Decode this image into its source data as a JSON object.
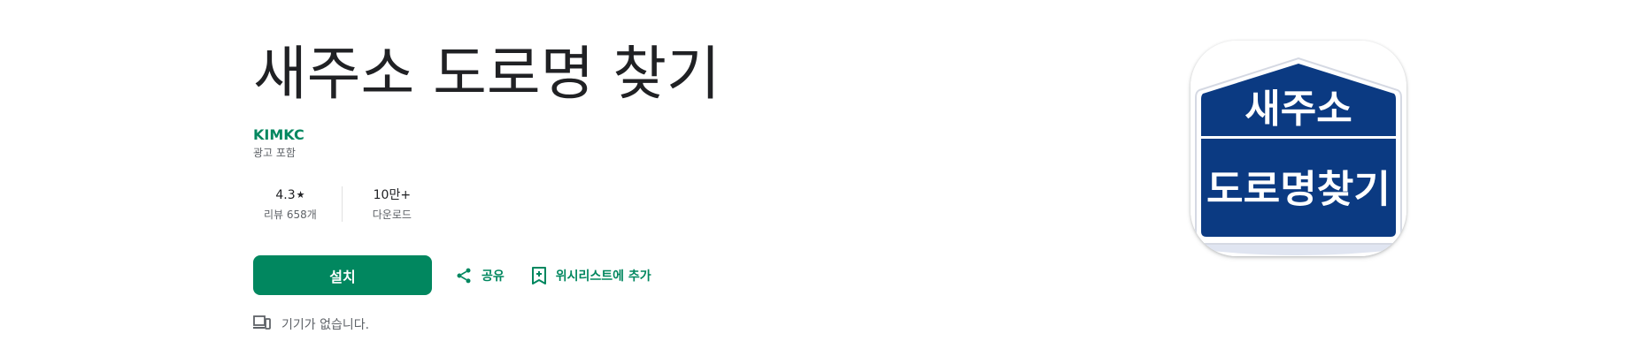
{
  "app": {
    "title": "새주소 도로명 찾기",
    "developer": "KIMKC",
    "ads_note": "광고 포함"
  },
  "stats": {
    "rating": {
      "value": "4.3",
      "star_symbol": "★",
      "label": "리뷰 658개"
    },
    "downloads": {
      "value": "10만+",
      "label": "다운로드"
    }
  },
  "actions": {
    "install_label": "설치",
    "share_label": "공유",
    "wishlist_label": "위시리스트에 추가"
  },
  "device_note": "기기가 없습니다.",
  "icon": {
    "line1": "새주소",
    "line2": "도로명찾기",
    "colors": {
      "navy": "#0b3a82",
      "white": "#ffffff",
      "shadow": "#c7d0e6"
    }
  },
  "colors": {
    "accent": "#01875f",
    "text": "#202124",
    "muted": "#5f6368"
  }
}
